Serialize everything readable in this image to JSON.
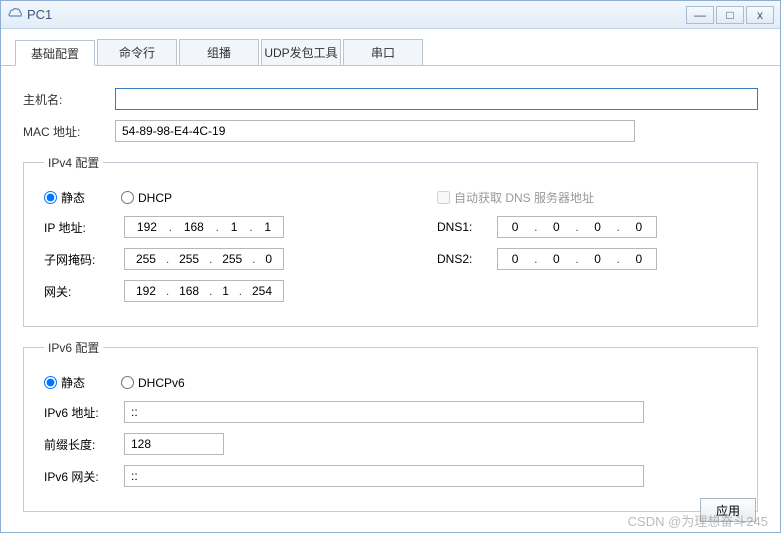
{
  "window": {
    "title": "PC1"
  },
  "tabs": [
    "基础配置",
    "命令行",
    "组播",
    "UDP发包工具",
    "串口"
  ],
  "active_tab": 0,
  "hostname_label": "主机名:",
  "hostname_value": "",
  "mac_label": "MAC 地址:",
  "mac_value": "54-89-98-E4-4C-19",
  "ipv4": {
    "legend": "IPv4 配置",
    "static_label": "静态",
    "dhcp_label": "DHCP",
    "auto_dns_label": "自动获取 DNS 服务器地址",
    "ip_label": "IP 地址:",
    "ip": [
      "192",
      "168",
      "1",
      "1"
    ],
    "mask_label": "子网掩码:",
    "mask": [
      "255",
      "255",
      "255",
      "0"
    ],
    "gw_label": "网关:",
    "gw": [
      "192",
      "168",
      "1",
      "254"
    ],
    "dns1_label": "DNS1:",
    "dns1": [
      "0",
      "0",
      "0",
      "0"
    ],
    "dns2_label": "DNS2:",
    "dns2": [
      "0",
      "0",
      "0",
      "0"
    ]
  },
  "ipv6": {
    "legend": "IPv6 配置",
    "static_label": "静态",
    "dhcp_label": "DHCPv6",
    "addr_label": "IPv6 地址:",
    "addr_value": "::",
    "prefix_label": "前缀长度:",
    "prefix_value": "128",
    "gw_label": "IPv6 网关:",
    "gw_value": "::"
  },
  "apply_label": "应用",
  "watermark": "CSDN @为理想奋斗245"
}
